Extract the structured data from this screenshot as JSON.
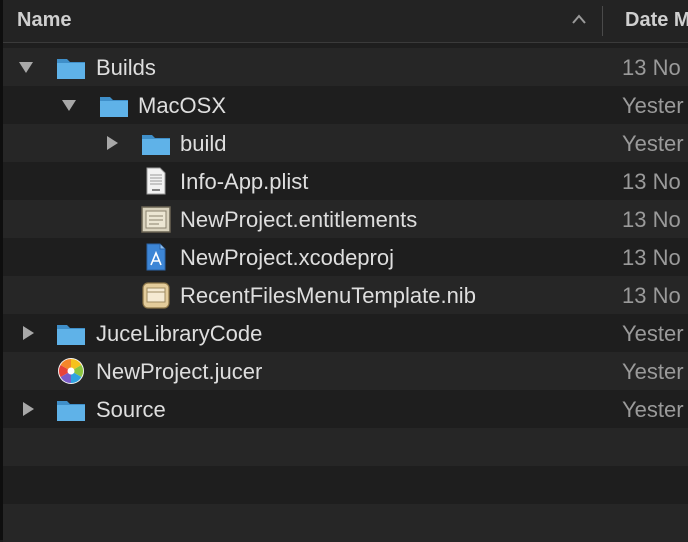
{
  "header": {
    "name_label": "Name",
    "date_label": "Date M"
  },
  "rows": [
    {
      "name": "Builds",
      "date": "13 No",
      "level": 0,
      "disclosure": "expanded",
      "icon": "folder-icon"
    },
    {
      "name": "MacOSX",
      "date": "Yester",
      "level": 1,
      "disclosure": "expanded",
      "icon": "folder-icon"
    },
    {
      "name": "build",
      "date": "Yester",
      "level": 2,
      "disclosure": "collapsed",
      "icon": "folder-icon"
    },
    {
      "name": "Info-App.plist",
      "date": "13 No",
      "level": 2,
      "disclosure": "none",
      "icon": "plist-file-icon"
    },
    {
      "name": "NewProject.entitlements",
      "date": "13 No",
      "level": 2,
      "disclosure": "none",
      "icon": "entitlements-file-icon"
    },
    {
      "name": "NewProject.xcodeproj",
      "date": "13 No",
      "level": 2,
      "disclosure": "none",
      "icon": "xcodeproj-file-icon"
    },
    {
      "name": "RecentFilesMenuTemplate.nib",
      "date": "13 No",
      "level": 2,
      "disclosure": "none",
      "icon": "nib-file-icon"
    },
    {
      "name": "JuceLibraryCode",
      "date": "Yester",
      "level": 0,
      "disclosure": "collapsed",
      "icon": "folder-icon"
    },
    {
      "name": "NewProject.jucer",
      "date": "Yester",
      "level": 0,
      "disclosure": "none",
      "icon": "jucer-file-icon"
    },
    {
      "name": "Source",
      "date": "Yester",
      "level": 0,
      "disclosure": "collapsed",
      "icon": "folder-icon"
    }
  ],
  "colors": {
    "background": "#1e1e1e",
    "alternate_row": "#262626",
    "folder_blue": "#4ea6df",
    "text": "#dedede",
    "date_text": "#9a9a9a"
  }
}
